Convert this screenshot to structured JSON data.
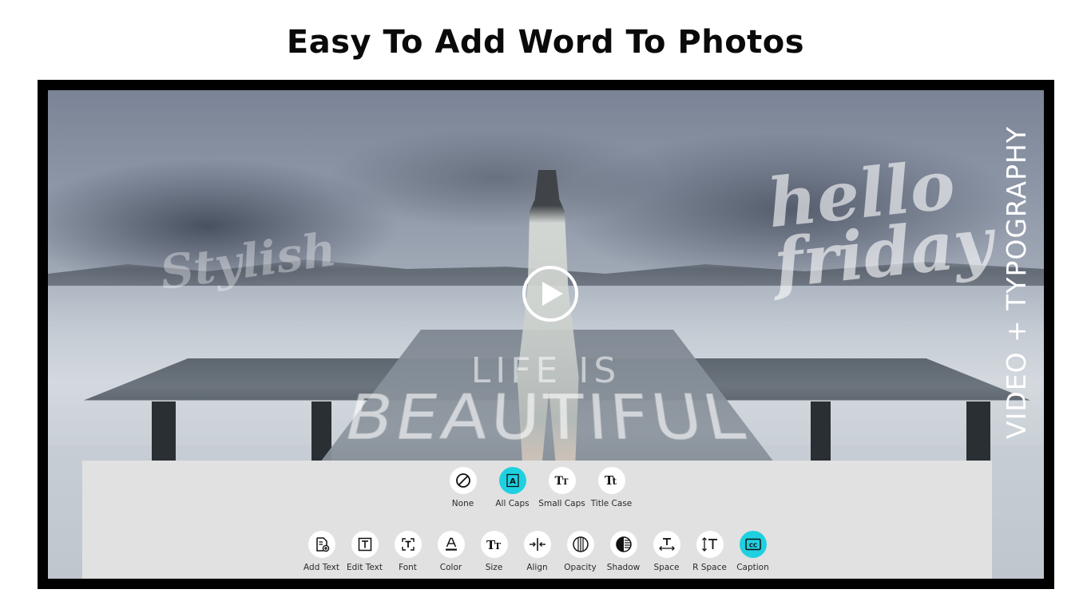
{
  "headline": "Easy To Add Word To Photos",
  "side_label": "VIDEO + TYPOGRAPHY",
  "overlay_texts": {
    "stylish": "Stylish",
    "hello": "hello",
    "friday": "friday",
    "life_is": "LIFE IS",
    "beautiful": "BEAUTIFUL"
  },
  "colors": {
    "active": "#1fd0e0",
    "panel": "#e1e1e1"
  },
  "case_options": [
    {
      "label": "None",
      "icon": "none-icon",
      "glyph": "",
      "active": false
    },
    {
      "label": "All Caps",
      "icon": "all-caps-icon",
      "glyph": "A",
      "active": true
    },
    {
      "label": "Small Caps",
      "icon": "small-caps-icon",
      "glyph": "TT",
      "active": false
    },
    {
      "label": "Title Case",
      "icon": "title-case-icon",
      "glyph": "Tt",
      "active": false
    }
  ],
  "tools": [
    {
      "label": "Add Text",
      "icon": "add-text-icon",
      "active": false
    },
    {
      "label": "Edit Text",
      "icon": "edit-text-icon",
      "active": false
    },
    {
      "label": "Font",
      "icon": "font-icon",
      "active": false
    },
    {
      "label": "Color",
      "icon": "color-icon",
      "active": false
    },
    {
      "label": "Size",
      "icon": "size-icon",
      "active": false
    },
    {
      "label": "Align",
      "icon": "align-icon",
      "active": false
    },
    {
      "label": "Opacity",
      "icon": "opacity-icon",
      "active": false
    },
    {
      "label": "Shadow",
      "icon": "shadow-icon",
      "active": false
    },
    {
      "label": "Space",
      "icon": "space-icon",
      "active": false
    },
    {
      "label": "R Space",
      "icon": "row-space-icon",
      "active": false
    },
    {
      "label": "Caption",
      "icon": "caption-icon",
      "active": true
    }
  ]
}
